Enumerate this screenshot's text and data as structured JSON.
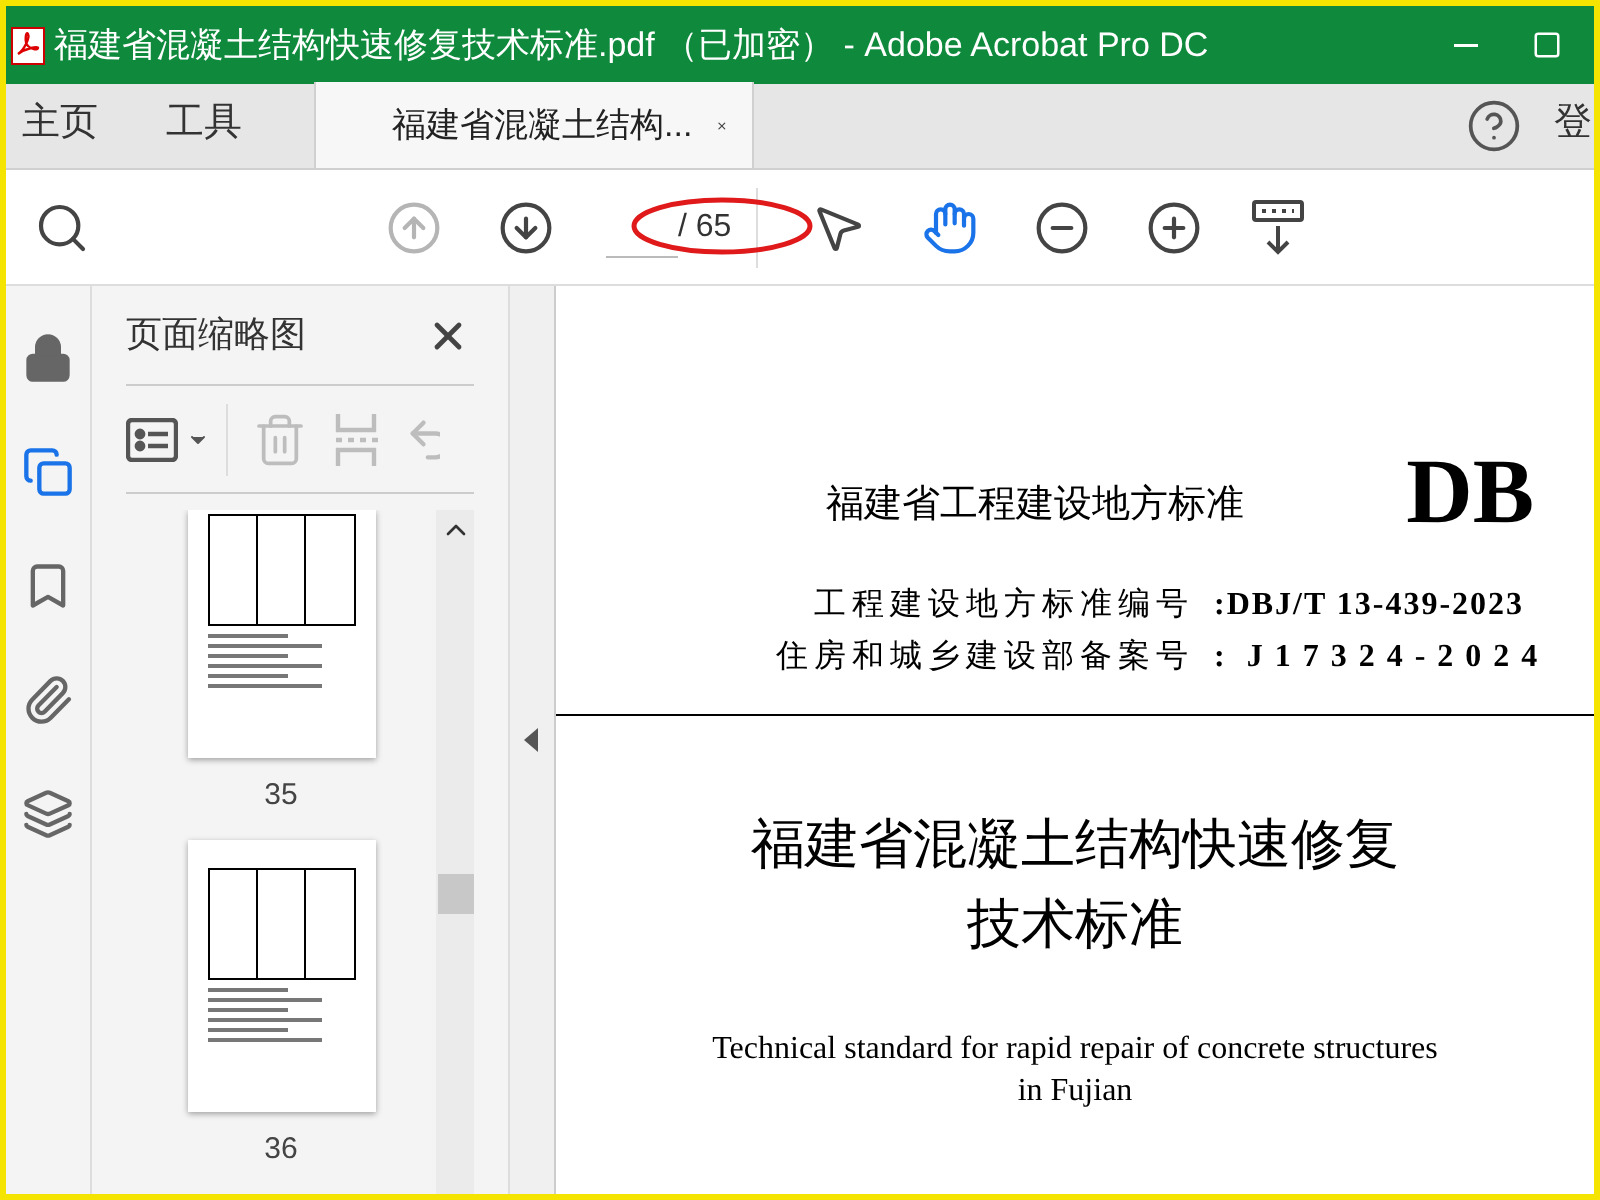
{
  "window": {
    "title": "福建省混凝土结构快速修复技术标准.pdf （已加密） - Adobe Acrobat Pro DC"
  },
  "tabs": [
    {
      "label": "主页",
      "selected": false
    },
    {
      "label": "工具",
      "selected": false
    },
    {
      "label": "福建省混凝土结构...",
      "selected": true,
      "closable": true
    }
  ],
  "account_label": "登",
  "toolbar": {
    "tools": [
      {
        "kind": "search"
      },
      {
        "kind": "prev",
        "disabled": true
      },
      {
        "kind": "next"
      },
      {
        "kind": "page",
        "total": "/ 65"
      },
      {
        "kind": "pointer",
        "selected": false
      },
      {
        "kind": "hand",
        "selected": true
      },
      {
        "kind": "zoom_out"
      },
      {
        "kind": "zoom_in"
      },
      {
        "kind": "more"
      }
    ]
  },
  "rail": [
    {
      "kind": "lock",
      "selected": false
    },
    {
      "kind": "pages",
      "selected": true
    },
    {
      "kind": "bookmark",
      "selected": false
    },
    {
      "kind": "attachment",
      "selected": false
    },
    {
      "kind": "layers",
      "selected": false
    }
  ],
  "thumbnail_panel": {
    "title": "页面缩略图",
    "tools": [
      {
        "kind": "options",
        "disabled": false
      },
      {
        "kind": "delete",
        "disabled": true
      },
      {
        "kind": "insert",
        "disabled": true
      },
      {
        "kind": "undo",
        "disabled": true
      }
    ],
    "pages": [
      {
        "label": "35",
        "cut_top": true
      },
      {
        "label": "36",
        "cut_top": false
      }
    ]
  },
  "document": {
    "series": "福建省工程建设地方标准",
    "mark": "DB",
    "codes": [
      {
        "label": "工程建设地方标准编号",
        "value": ":DBJ/T 13-439-2023"
      },
      {
        "label": "住房和城乡建设部备案号",
        "value": ":  J 1 7 3 2 4 - 2 0 2 4"
      }
    ],
    "title_lines": [
      "福建省混凝土结构快速修复",
      "技术标准"
    ],
    "english_lines": [
      "Technical standard for rapid repair of concrete structures",
      "in Fujian"
    ]
  }
}
